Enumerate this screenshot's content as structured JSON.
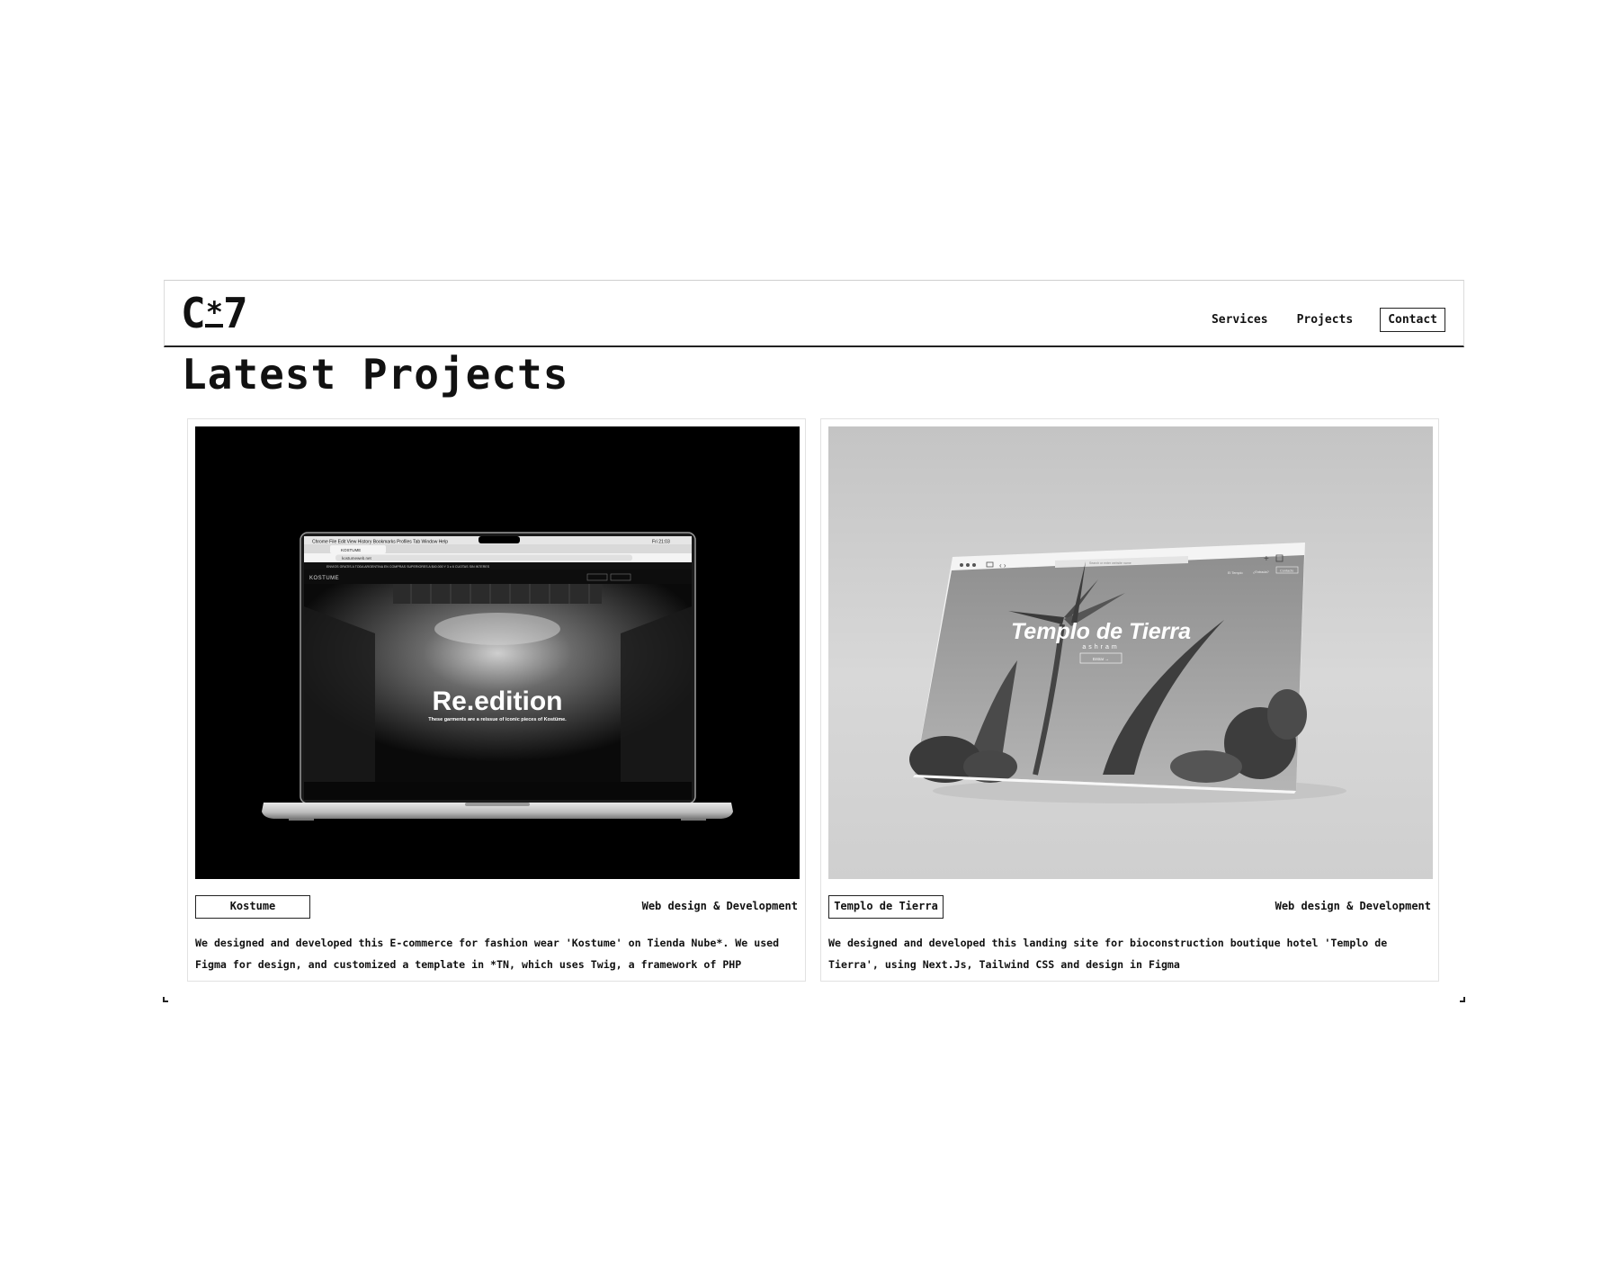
{
  "navbar": {
    "logo_left": "C",
    "logo_star": "*",
    "logo_right": "7",
    "links": [
      {
        "label": "Services"
      },
      {
        "label": "Projects"
      }
    ],
    "contact_label": "Contact"
  },
  "section": {
    "title": "Latest Projects"
  },
  "projects": [
    {
      "name": "Kostume",
      "category": "Web design & Development",
      "description": "We designed and developed this E-commerce for fashion wear 'Kostume' on Tienda Nube*. We used Figma for design, and customized a template in *TN, which uses Twig, a framework of PHP",
      "image": {
        "headline": "Re.edition",
        "subline": "These garments are a reissue of iconic pieces of Kostüme.",
        "site_brand": "KOSTUME",
        "menu_items": [
          "Chrome",
          "File",
          "Edit",
          "View",
          "History",
          "Bookmarks",
          "Profiles",
          "Tab",
          "Window",
          "Help"
        ],
        "url": "kostumeweb.net",
        "announcement": "ENVIOS GRATIS A TODA ARGENTINA EN COMPRAS SUPERIORES A $40.000 Y 3 o 6 CUOTAS SIN INTERES",
        "time": "Fri 21:03"
      }
    },
    {
      "name": "Templo de Tierra",
      "category": "Web design & Development",
      "description": "We designed and developed this landing site for bioconstruction boutique hotel 'Templo de Tierra', using Next.Js, Tailwind CSS and design in Figma",
      "image": {
        "headline": "Templo de Tierra",
        "subline": "ashram",
        "button": "Entrar →",
        "nav_left": "El Templo",
        "nav_mid": "¿Entrada?",
        "nav_right": "Contacto",
        "search": "Search or enter website name"
      }
    }
  ],
  "colors": {
    "text": "#111111",
    "border": "#222222",
    "card_border": "#e2e2e2",
    "background": "#ffffff"
  }
}
